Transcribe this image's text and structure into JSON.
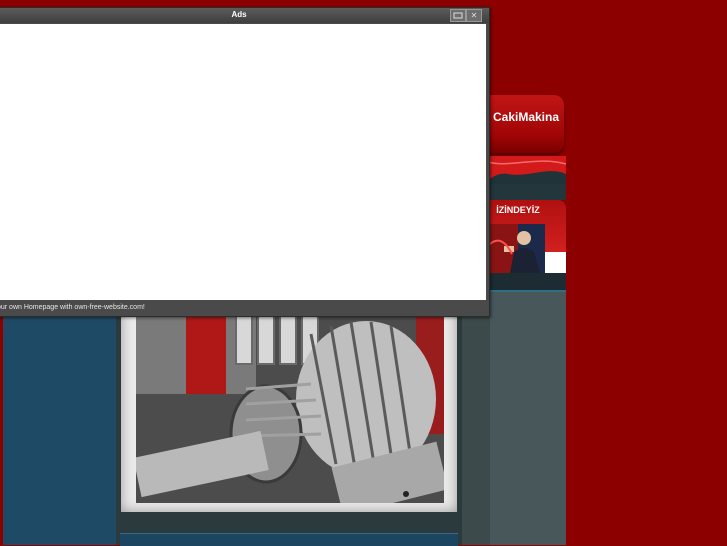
{
  "brand": {
    "name": "CakiMakina"
  },
  "sidebar": {
    "follow_label": "İZİNDEYİZ"
  },
  "ads_window": {
    "title": "Ads",
    "status_text": "our own Homepage with own-free-website.com!",
    "minimize_icon": "window-icon",
    "close_icon": "close-icon",
    "close_glyph": "✕"
  },
  "colors": {
    "page_bg": "#8c0000",
    "brand_red": "#c21515",
    "left_column": "#1f4a66",
    "panel_gray": "#3c4a4b",
    "window_chrome": "#4a4a4a"
  }
}
